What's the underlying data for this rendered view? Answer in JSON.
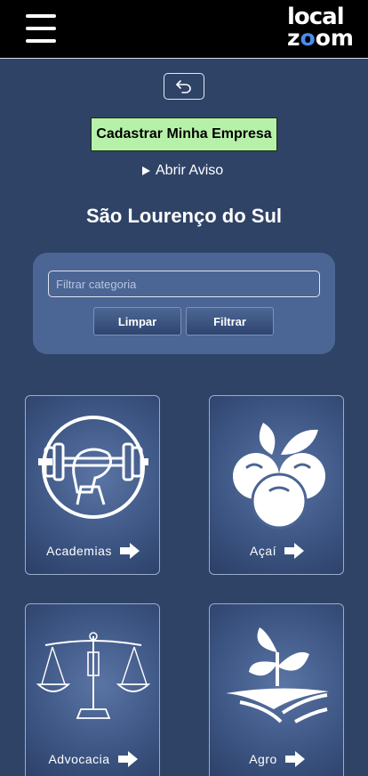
{
  "header": {
    "menu_icon": "hamburger-menu-icon",
    "logo_line1": "local",
    "logo_line2_z": "z",
    "logo_line2_o": "o",
    "logo_line2_rest": "om"
  },
  "back_button_icon": "undo-arrow-icon",
  "register_button": "Cadastrar Minha Empresa",
  "notice_toggle": "Abrir Aviso",
  "city_title": "São Lourenço do Sul",
  "filter": {
    "placeholder": "Filtrar categoria",
    "clear_label": "Limpar",
    "filter_label": "Filtrar"
  },
  "categories": [
    {
      "label": "Academias",
      "icon": "dumbbell-fist-icon"
    },
    {
      "label": "Açaí",
      "icon": "acai-berries-icon"
    },
    {
      "label": "Advocacia",
      "icon": "scales-of-justice-icon"
    },
    {
      "label": "Agro",
      "icon": "sprout-field-icon"
    }
  ]
}
